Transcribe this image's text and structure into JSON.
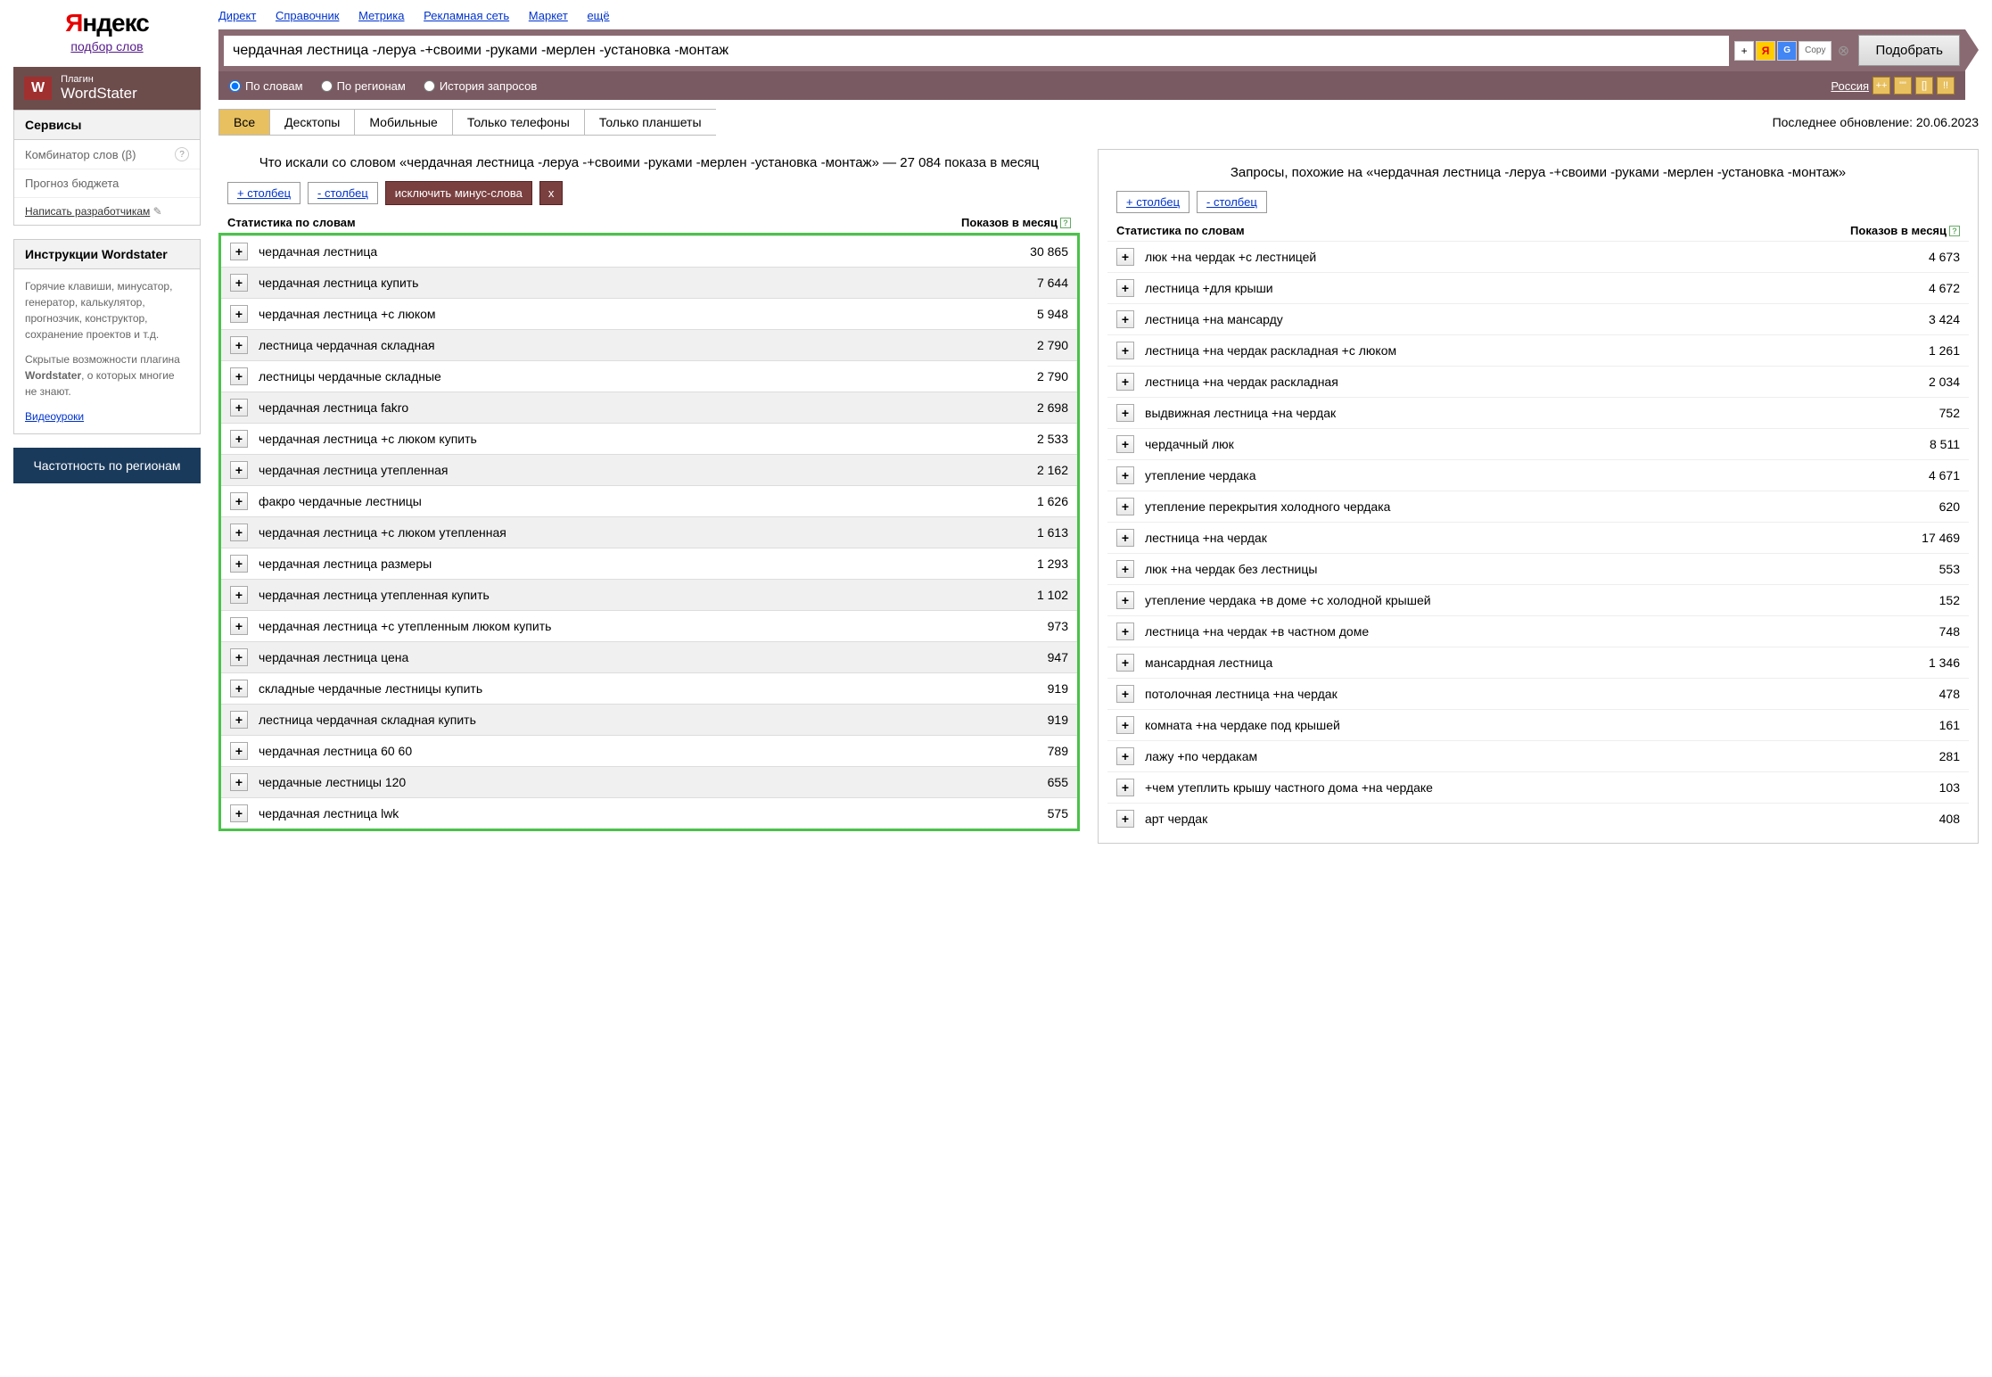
{
  "logo": {
    "first": "Я",
    "rest": "ндекс",
    "sub": "подбор слов"
  },
  "plugin": {
    "label": "Плагин",
    "name": "WordStater"
  },
  "sidebar": {
    "services_heading": "Сервисы",
    "combinator": "Комбинатор слов (β)",
    "budget": "Прогноз бюджета",
    "write_dev": "Написать разработчикам",
    "instructions_heading": "Инструкции Wordstater",
    "text1": "Горячие клавиши, минусатор, генератор, калькулятор, прогнозчик, конструктор, сохранение проектов и т.д.",
    "text2_a": "Скрытые возможности плагина ",
    "text2_b": "Wordstater",
    "text2_c": ", о которых многие не знают.",
    "video": "Видеоуроки",
    "region_btn": "Частотность по регионам"
  },
  "top_links": [
    "Директ",
    "Справочник",
    "Метрика",
    "Рекламная сеть",
    "Маркет",
    "ещё"
  ],
  "search": {
    "value": "чердачная лестница -леруа -+своими -руками -мерлен -установка -монтаж",
    "copy": "Copy",
    "submit": "Подобрать"
  },
  "filters": {
    "by_words": "По словам",
    "by_regions": "По регионам",
    "history": "История запросов",
    "region": "Россия"
  },
  "tabs": {
    "all": "Все",
    "desktop": "Десктопы",
    "mobile": "Мобильные",
    "phones": "Только телефоны",
    "tablets": "Только планшеты"
  },
  "update": "Последнее обновление: 20.06.2023",
  "left": {
    "title": "Что искали со словом «чердачная лестница -леруа -+своими -руками -мерлен -установка -монтаж» — 27 084 показа в месяц",
    "add_col": "+ столбец",
    "del_col": "- столбец",
    "exclude": "исключить минус-слова",
    "x": "x",
    "th1": "Статистика по словам",
    "th2": "Показов в месяц",
    "rows": [
      {
        "t": "чердачная лестница",
        "n": "30 865"
      },
      {
        "t": "чердачная лестница купить",
        "n": "7 644"
      },
      {
        "t": "чердачная лестница +с люком",
        "n": "5 948"
      },
      {
        "t": "лестница чердачная складная",
        "n": "2 790"
      },
      {
        "t": "лестницы чердачные складные",
        "n": "2 790"
      },
      {
        "t": "чердачная лестница fakro",
        "n": "2 698"
      },
      {
        "t": "чердачная лестница +с люком купить",
        "n": "2 533"
      },
      {
        "t": "чердачная лестница утепленная",
        "n": "2 162"
      },
      {
        "t": "факро чердачные лестницы",
        "n": "1 626"
      },
      {
        "t": "чердачная лестница +с люком утепленная",
        "n": "1 613"
      },
      {
        "t": "чердачная лестница размеры",
        "n": "1 293"
      },
      {
        "t": "чердачная лестница утепленная купить",
        "n": "1 102"
      },
      {
        "t": "чердачная лестница +с утепленным люком купить",
        "n": "973"
      },
      {
        "t": "чердачная лестница цена",
        "n": "947"
      },
      {
        "t": "складные чердачные лестницы купить",
        "n": "919"
      },
      {
        "t": "лестница чердачная складная купить",
        "n": "919"
      },
      {
        "t": "чердачная лестница 60 60",
        "n": "789"
      },
      {
        "t": "чердачные лестницы 120",
        "n": "655"
      },
      {
        "t": "чердачная лестница lwk",
        "n": "575"
      }
    ]
  },
  "right": {
    "title": "Запросы, похожие на «чердачная лестница -леруа -+своими -руками -мерлен -установка -монтаж»",
    "add_col": "+ столбец",
    "del_col": "- столбец",
    "th1": "Статистика по словам",
    "th2": "Показов в месяц",
    "rows": [
      {
        "t": "люк +на чердак +с лестницей",
        "n": "4 673"
      },
      {
        "t": "лестница +для крыши",
        "n": "4 672"
      },
      {
        "t": "лестница +на мансарду",
        "n": "3 424"
      },
      {
        "t": "лестница +на чердак раскладная +с люком",
        "n": "1 261"
      },
      {
        "t": "лестница +на чердак раскладная",
        "n": "2 034"
      },
      {
        "t": "выдвижная лестница +на чердак",
        "n": "752"
      },
      {
        "t": "чердачный люк",
        "n": "8 511"
      },
      {
        "t": "утепление чердака",
        "n": "4 671"
      },
      {
        "t": "утепление перекрытия холодного чердака",
        "n": "620"
      },
      {
        "t": "лестница +на чердак",
        "n": "17 469"
      },
      {
        "t": "люк +на чердак без лестницы",
        "n": "553"
      },
      {
        "t": "утепление чердака +в доме +с холодной крышей",
        "n": "152"
      },
      {
        "t": "лестница +на чердак +в частном доме",
        "n": "748"
      },
      {
        "t": "мансардная лестница",
        "n": "1 346"
      },
      {
        "t": "потолочная лестница +на чердак",
        "n": "478"
      },
      {
        "t": "комната +на чердаке под крышей",
        "n": "161"
      },
      {
        "t": "лажу +по чердакам",
        "n": "281"
      },
      {
        "t": "+чем утеплить крышу частного дома +на чердаке",
        "n": "103"
      },
      {
        "t": "арт чердак",
        "n": "408"
      }
    ]
  }
}
